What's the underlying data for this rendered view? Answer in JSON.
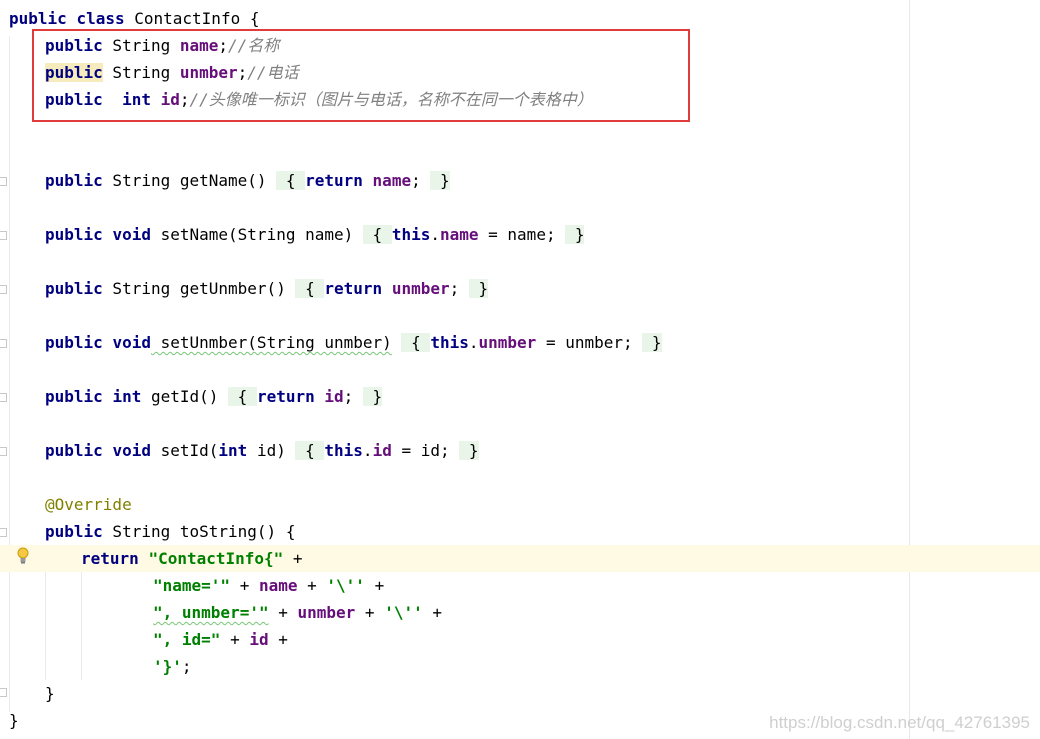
{
  "code": {
    "class_decl": {
      "kw1": "public",
      "kw2": "class",
      "name": " ContactInfo {"
    },
    "field_name": {
      "kw": "public",
      "type": " String ",
      "field": "name",
      "semi": ";",
      "comment": "//名称"
    },
    "field_unmber": {
      "kw": "public",
      "type": " String ",
      "field": "unmber",
      "semi": ";",
      "comment": "//电话"
    },
    "field_id": {
      "kw": "public",
      "type": " int",
      "field": "id",
      "semi": ";",
      "comment": "//头像唯一标识（图片与电话，名称不在同一个表格中）"
    },
    "getName": {
      "kw": "public",
      "sig": " String getName()",
      "ret": "return",
      "field": "name",
      "end": "; "
    },
    "setName": {
      "kw": "public",
      "kw2": "void",
      "sig": " setName(String name)",
      "this": "this",
      "field": "name",
      "end": " = name; "
    },
    "getUnmber": {
      "kw": "public",
      "sig": " String getUnmber()",
      "ret": "return",
      "field": "unmber",
      "end": "; "
    },
    "setUnmber": {
      "kw": "public",
      "kw2": "void",
      "sig": " setUnmber(String unmber)",
      "this": "this",
      "field": "unmber",
      "end": " = unmber; "
    },
    "getId": {
      "kw": "public",
      "kw2": "int",
      "sig": " getId()",
      "ret": "return",
      "field": "id",
      "end": "; "
    },
    "setId": {
      "kw": "public",
      "kw2": "void",
      "sig": " setId(",
      "kw3": "int",
      "sig2": " id)",
      "this": "this",
      "field": "id",
      "end": " = id; "
    },
    "override": "@Override",
    "toString": {
      "kw": "public",
      "sig": " String toString() {"
    },
    "ret_line": {
      "ret": "return",
      "str": "\"ContactInfo{\"",
      "plus": " +"
    },
    "name_line": {
      "str": "\"name='\"",
      "mid": " + ",
      "field": "name",
      "mid2": " + ",
      "chr": "'\\''",
      "plus": " +"
    },
    "unmber_line": {
      "str": "\", unmber='\"",
      "mid": " + ",
      "field": "unmber",
      "mid2": " + ",
      "chr": "'\\''",
      "plus": " +"
    },
    "id_line": {
      "str": "\", id=\"",
      "mid": " + ",
      "field": "id",
      "plus": " +"
    },
    "close_str": {
      "chr": "'}'",
      "semi": ";"
    },
    "method_close": "}",
    "class_close": "}"
  },
  "watermark": "https://blog.csdn.net/qq_42761395",
  "colors": {
    "keyword": "#000080",
    "field": "#660e7a",
    "comment": "#808080",
    "string": "#008000",
    "annotation": "#808000",
    "highlight_box": "#e03c3c"
  }
}
